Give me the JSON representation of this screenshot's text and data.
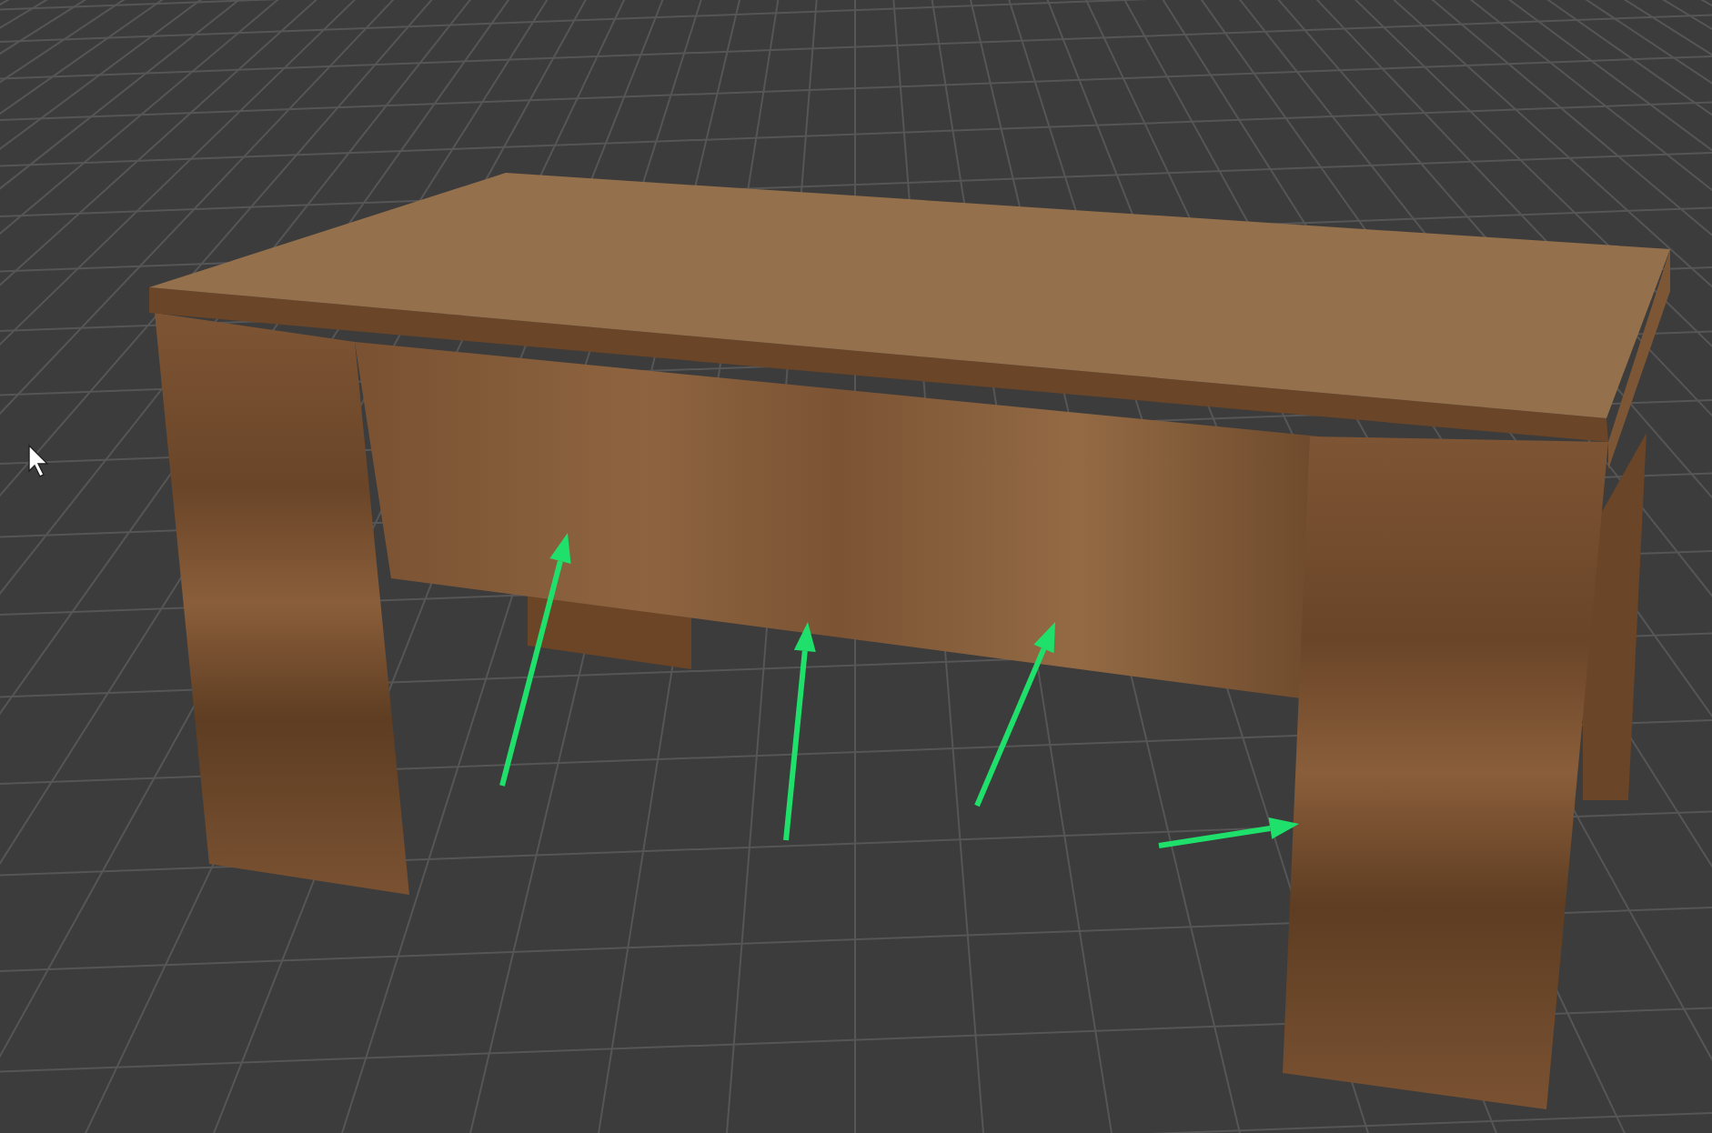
{
  "viewport": {
    "model": {
      "kind": "desk"
    },
    "cursor": {
      "kind": "pointer"
    },
    "annotations": [
      {
        "kind": "arrow"
      },
      {
        "kind": "arrow"
      },
      {
        "kind": "arrow"
      },
      {
        "kind": "arrow"
      }
    ]
  }
}
